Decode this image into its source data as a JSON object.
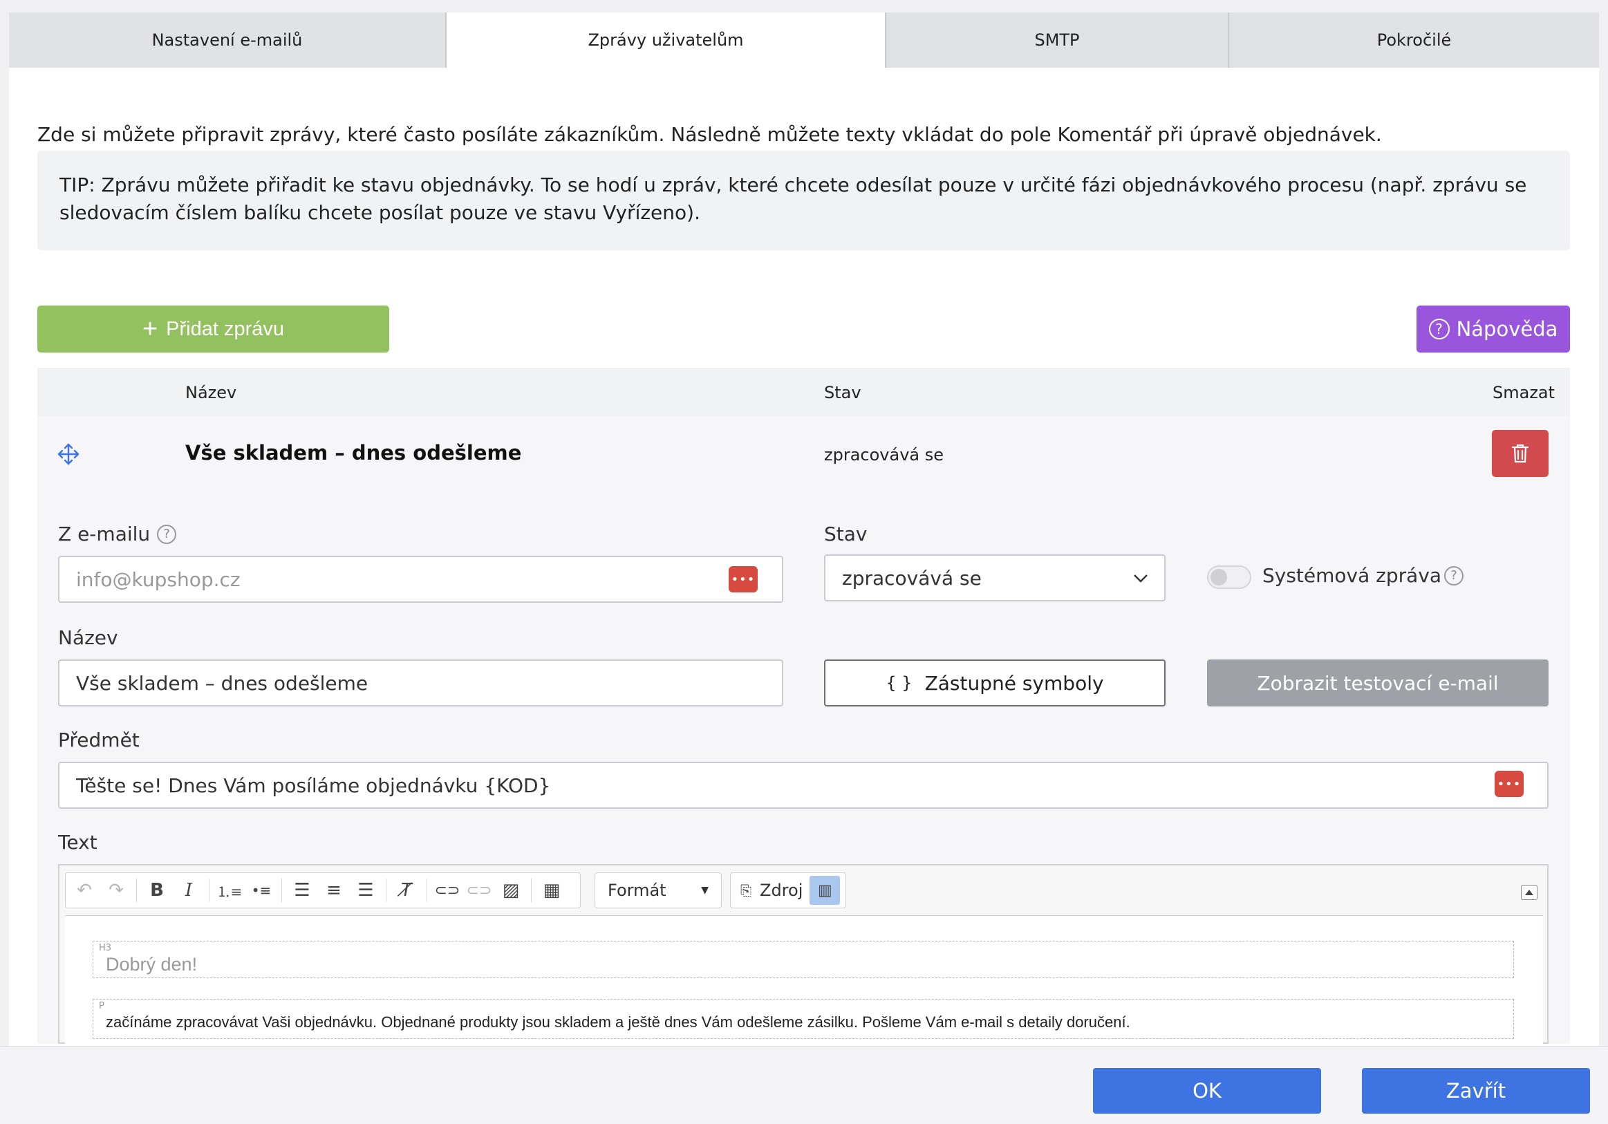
{
  "tabs": [
    {
      "label": "Nastavení e-mailů"
    },
    {
      "label": "Zprávy uživatelům"
    },
    {
      "label": "SMTP"
    },
    {
      "label": "Pokročilé"
    }
  ],
  "intro": "Zde si můžete připravit zprávy, které často posíláte zákazníkům. Následně můžete texty vkládat do pole Komentář při úpravě objednávek.",
  "tip": "TIP: Zprávu můžete přiřadit ke stavu objednávky. To se hodí u zpráv, které chcete odesílat pouze v určité fázi objednávkového procesu (např. zprávu se sledovacím číslem balíku chcete posílat pouze ve stavu Vyřízeno).",
  "actions": {
    "add_label": "Přidat zprávu",
    "help_label": "Nápověda"
  },
  "table": {
    "headers": {
      "name": "Název",
      "state": "Stav",
      "delete": "Smazat"
    },
    "row": {
      "title": "Vše skladem – dnes odešleme",
      "state": "zpracovává se"
    }
  },
  "form": {
    "from_label": "Z e-mailu",
    "from_placeholder": "info@kupshop.cz",
    "state_label": "Stav",
    "state_value": "zpracovává se",
    "system_label": "Systémová zpráva",
    "name_label": "Název",
    "name_value": "Vše skladem – dnes odešleme",
    "placeholders_label": "Zástupné symboly",
    "test_email_label": "Zobrazit testovací e-mail",
    "subject_label": "Předmět",
    "subject_value": "Těšte se! Dnes Vám posíláme objednávku {KOD}",
    "text_label": "Text"
  },
  "editor": {
    "format_label": "Formát",
    "source_label": "Zdroj",
    "block1_tag": "H3",
    "block1_text": "Dobrý den!",
    "block2_tag": "P",
    "block2_text": "začínáme zpracovávat Vaši objednávku. Objednané produkty jsou skladem a ještě dnes Vám odešleme zásilku. Pošleme Vám e-mail s detaily doručení."
  },
  "footer": {
    "ok_label": "OK",
    "close_label": "Zavřít"
  }
}
